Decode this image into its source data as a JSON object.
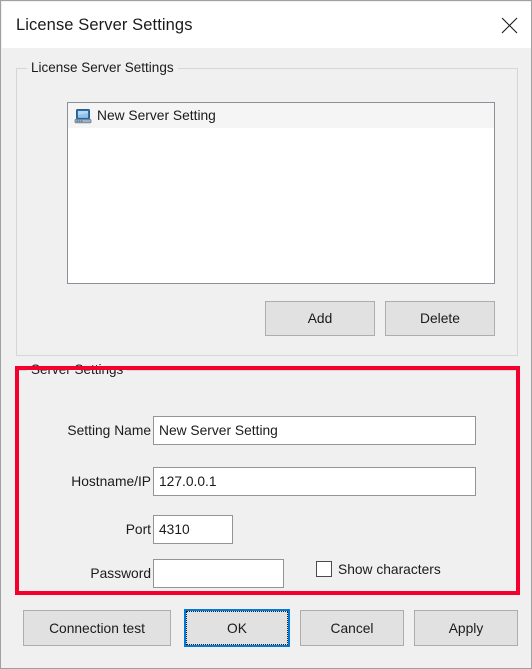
{
  "window": {
    "title": "License Server Settings",
    "close_icon": "close-icon"
  },
  "license_group": {
    "title": "License Server Settings",
    "list_items": [
      {
        "icon": "computer-icon",
        "label": "New Server Setting"
      }
    ],
    "add_label": "Add",
    "delete_label": "Delete"
  },
  "server_group": {
    "title": "Server Settings",
    "fields": {
      "setting_name": {
        "label": "Setting Name",
        "value": "New Server Setting",
        "placeholder": ""
      },
      "hostname": {
        "label": "Hostname/IP",
        "value": "127.0.0.1",
        "placeholder": ""
      },
      "port": {
        "label": "Port",
        "value": "4310",
        "placeholder": ""
      },
      "password": {
        "label": "Password",
        "value": "",
        "placeholder": ""
      }
    },
    "show_characters": {
      "label": "Show characters",
      "checked": false
    }
  },
  "footer": {
    "connection_test_label": "Connection test",
    "ok_label": "OK",
    "cancel_label": "Cancel",
    "apply_label": "Apply"
  },
  "colors": {
    "annotation_red": "#f5002e",
    "focus_blue": "#0078d7",
    "dialog_bg": "#f0f0f0",
    "titlebar_bg": "#ffffff",
    "button_bg": "#e1e1e1",
    "icon_blue": "#2a6fb5"
  }
}
